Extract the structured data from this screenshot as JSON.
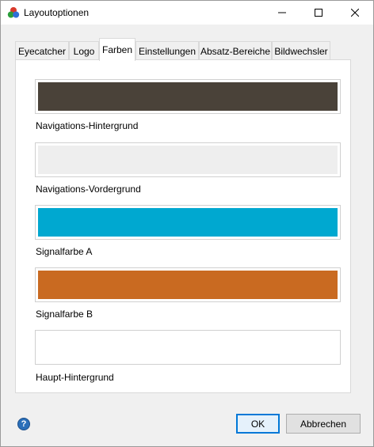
{
  "window": {
    "title": "Layoutoptionen",
    "icon": "app-color-balls-icon"
  },
  "titlebar_buttons": {
    "minimize_icon": "minimize-icon",
    "maximize_icon": "maximize-icon",
    "close_icon": "close-icon"
  },
  "tabs": [
    {
      "label": "Eyecatcher",
      "active": false
    },
    {
      "label": "Logo",
      "active": false
    },
    {
      "label": "Farben",
      "active": true
    },
    {
      "label": "Einstellungen",
      "active": false
    },
    {
      "label": "Absatz-Bereiche",
      "active": false
    },
    {
      "label": "Bildwechsler",
      "active": false
    }
  ],
  "colors": [
    {
      "label": "Navigations-Hintergrund",
      "color": "#4a4239"
    },
    {
      "label": "Navigations-Vordergrund",
      "color": "#eeeeee"
    },
    {
      "label": "Signalfarbe A",
      "color": "#00a8d0"
    },
    {
      "label": "Signalfarbe B",
      "color": "#c96a21"
    },
    {
      "label": "Haupt-Hintergrund",
      "color": "#ffffff"
    }
  ],
  "footer": {
    "help_icon": "help-icon",
    "help_glyph": "?",
    "ok_label": "OK",
    "cancel_label": "Abbrechen"
  }
}
